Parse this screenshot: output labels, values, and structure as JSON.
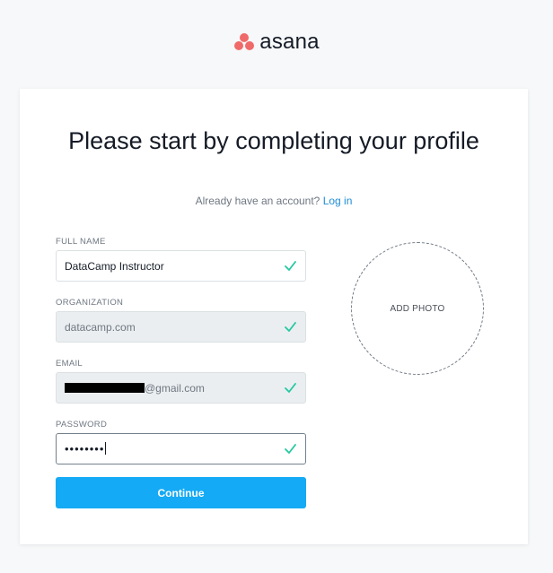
{
  "brand": {
    "name": "asana",
    "logo_color": "#f06a6a"
  },
  "headline": "Please start by completing your profile",
  "subline": {
    "text": "Already have an account?",
    "link": "Log in"
  },
  "form": {
    "full_name": {
      "label": "FULL NAME",
      "value": "DataCamp Instructor"
    },
    "organization": {
      "label": "ORGANIZATION",
      "value": "datacamp.com"
    },
    "email": {
      "label": "EMAIL",
      "value_suffix": "@gmail.com"
    },
    "password": {
      "label": "PASSWORD",
      "value": "••••••••"
    },
    "continue_label": "Continue"
  },
  "photo": {
    "label": "ADD PHOTO"
  },
  "colors": {
    "accent": "#14aaf5",
    "check": "#25c8a1",
    "link": "#1f8dd6"
  }
}
